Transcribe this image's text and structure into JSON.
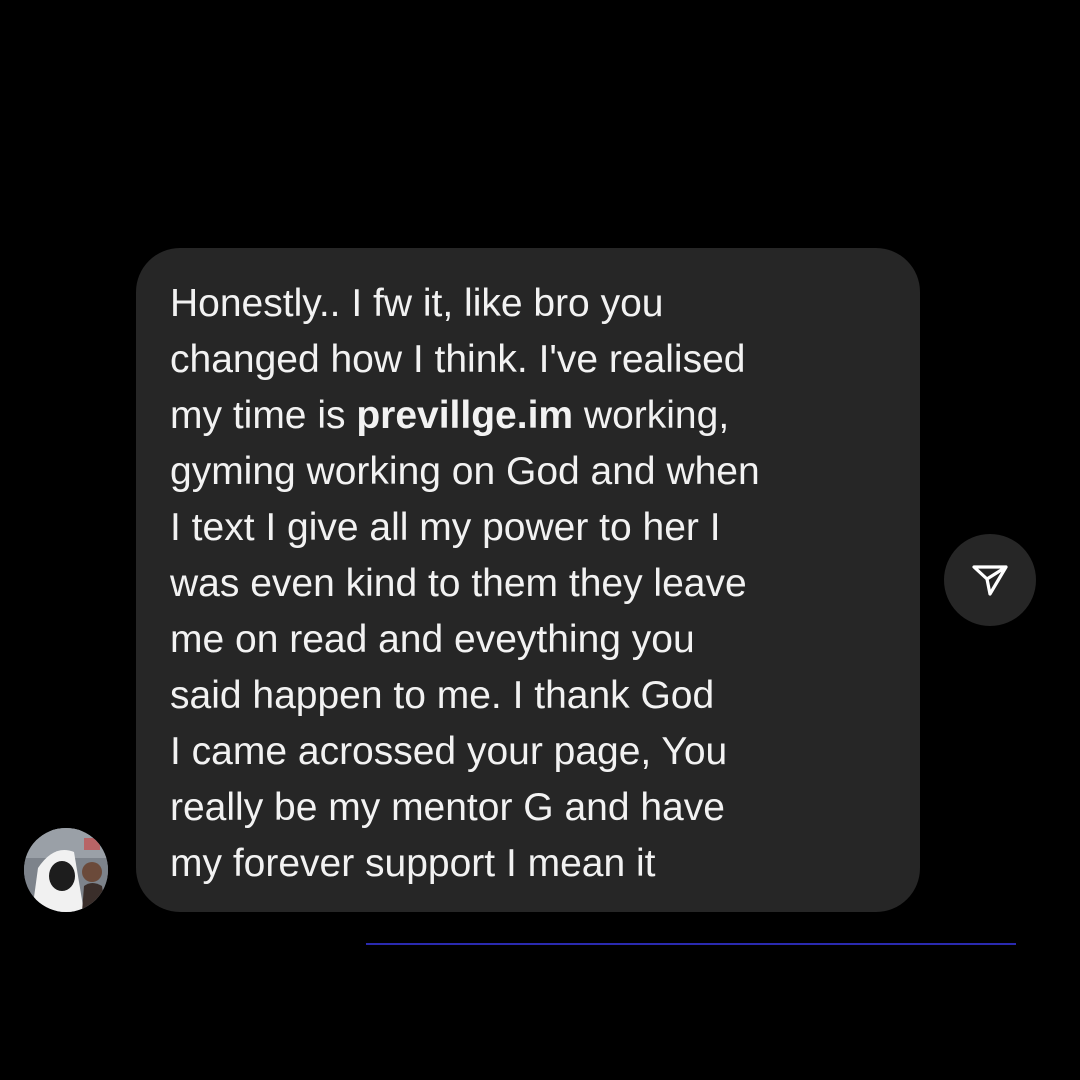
{
  "message": {
    "lines": [
      "Honestly.. I fw it, like bro you",
      "changed how I think. I've realised",
      "gyming working on God and when",
      "I text I give all my power to her I",
      "was even kind to them they leave",
      "me on read and eveything you",
      "said happen to me. I thank God",
      "I came acrossed your page, You",
      "really be my mentor G and have",
      "my forever support I mean it"
    ],
    "line3_before": "my time is ",
    "line3_bold": "previllge.im",
    "line3_after": " working,"
  },
  "icons": {
    "share": "paper-plane-icon",
    "avatar": "profile-avatar"
  },
  "colors": {
    "background": "#000000",
    "bubble": "#262626",
    "text": "#f2f2f2",
    "share_button": "#262626",
    "underline": "#2a2ab0"
  }
}
